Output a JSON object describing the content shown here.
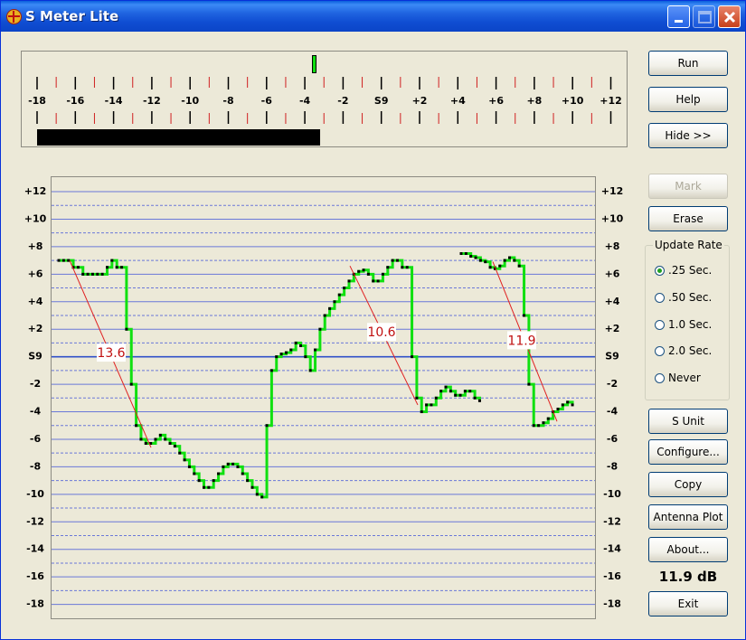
{
  "window": {
    "title": "S Meter Lite"
  },
  "meter": {
    "scale_labels": [
      "-18",
      "-16",
      "-14",
      "-12",
      "-10",
      "-8",
      "-6",
      "-4",
      "-2",
      "S9",
      "+2",
      "+4",
      "+6",
      "+8",
      "+10",
      "+12"
    ],
    "bar_level": -3.2,
    "peak_level": -3.2
  },
  "buttons": {
    "run": "Run",
    "help": "Help",
    "hide": "Hide >>",
    "mark": "Mark",
    "erase": "Erase",
    "s_unit": "S Unit",
    "configure": "Configure...",
    "copy": "Copy",
    "antenna_plot": "Antenna Plot",
    "about": "About...",
    "exit": "Exit"
  },
  "update_rate": {
    "label": "Update Rate",
    "options": [
      ".25 Sec.",
      ".50 Sec.",
      "1.0 Sec.",
      "2.0 Sec.",
      "Never"
    ],
    "selected": ".25 Sec."
  },
  "readout": "11.9 dB",
  "chart_data": {
    "type": "line",
    "y_ticks": [
      "+12",
      "+10",
      "+8",
      "+6",
      "+4",
      "+2",
      "S9",
      "-2",
      "-4",
      "-6",
      "-8",
      "-10",
      "-12",
      "-14",
      "-16",
      "-18"
    ],
    "ylim": [
      -18,
      12
    ],
    "series": [
      {
        "values": [
          7,
          7,
          7,
          6.5,
          6.5,
          6,
          6,
          6,
          6,
          6,
          6.5,
          7,
          6.5,
          6.5,
          2,
          -2,
          -5,
          -6,
          -6.3,
          -6.3,
          -6,
          -5.7,
          -6,
          -6.3,
          -6.5,
          -7,
          -7.5,
          -8,
          -8.5,
          -9,
          -9.5,
          -9.5,
          -9,
          -8.5,
          -8,
          -7.8,
          -7.8,
          -8,
          -8.5,
          -9,
          -9.5,
          -10,
          -10.2,
          -5,
          -1,
          0,
          0.2,
          0.3,
          0.5,
          1,
          0.8,
          0,
          -1,
          0.5,
          2,
          3,
          3.5,
          4,
          4.5,
          5,
          5.5,
          6,
          6.2,
          6.3,
          6,
          5.5,
          5.5,
          6,
          6.5,
          7,
          7,
          6.5,
          6.5,
          0,
          -3,
          -4,
          -3.5,
          -3.5,
          -3,
          -2.5,
          -2.2,
          -2.5,
          -2.8,
          -2.8,
          -2.5,
          -2.5,
          -3,
          -3.2
        ]
      },
      {
        "values": [
          7.5,
          7.5,
          7.3,
          7.2,
          7,
          6.9,
          6.5,
          6.4,
          6.6,
          7,
          7.2,
          7,
          6.6,
          3,
          -2,
          -5,
          -5,
          -4.8,
          -4.5,
          -4,
          -3.8,
          -3.5,
          -3.3,
          -3.5
        ]
      }
    ],
    "gaps": [
      "between series 1 and series 2"
    ],
    "annotations": [
      "13.6",
      "10.6",
      "11.9"
    ]
  }
}
